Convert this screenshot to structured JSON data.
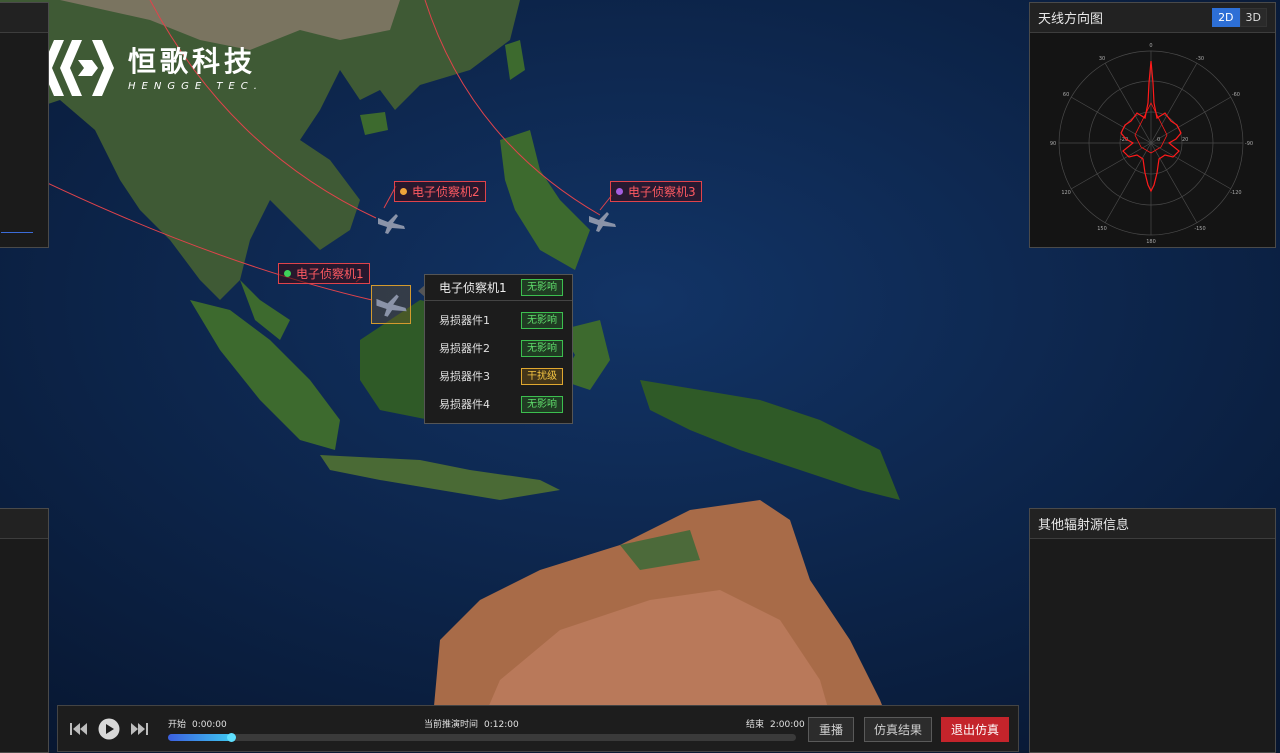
{
  "brand": {
    "name_cn": "恒歌科技",
    "name_en": "HENGGE TEC."
  },
  "panels": {
    "antenna": {
      "title": "天线方向图",
      "toggle": [
        "2D",
        "3D"
      ],
      "active": "2D"
    },
    "other_emitters": {
      "title": "其他辐射源信息"
    }
  },
  "aircraft": [
    {
      "label": "电子侦察机1",
      "dot_color": "#3fd15a"
    },
    {
      "label": "电子侦察机2",
      "dot_color": "#f0a53a"
    },
    {
      "label": "电子侦察机3",
      "dot_color": "#a35ee0"
    }
  ],
  "popup": {
    "title": "电子侦察机1",
    "title_status": "无影响",
    "rows": [
      {
        "name": "易损器件1",
        "status": "无影响",
        "level": "green"
      },
      {
        "name": "易损器件2",
        "status": "无影响",
        "level": "green"
      },
      {
        "name": "易损器件3",
        "status": "干扰级",
        "level": "yellow"
      },
      {
        "name": "易损器件4",
        "status": "无影响",
        "level": "green"
      }
    ]
  },
  "timeline": {
    "start_label": "开始",
    "start_value": "0:00:00",
    "current_label": "当前推演时间",
    "current_value": "0:12:00",
    "end_label": "结束",
    "end_value": "2:00:00",
    "progress": 0.1,
    "buttons": {
      "replay": "重播",
      "results": "仿真结果",
      "exit": "退出仿真"
    }
  },
  "polar_labels": [
    "0",
    "-30",
    "-60",
    "-90",
    "-120",
    "-150",
    "180",
    "150",
    "120",
    "90",
    "60",
    "30",
    "20",
    "0",
    "-20"
  ],
  "colors": {
    "accent_blue": "#2d6fd6",
    "exit_red": "#c4242b",
    "trajectory": "#e0434b",
    "pattern": "#ff1a1a"
  }
}
